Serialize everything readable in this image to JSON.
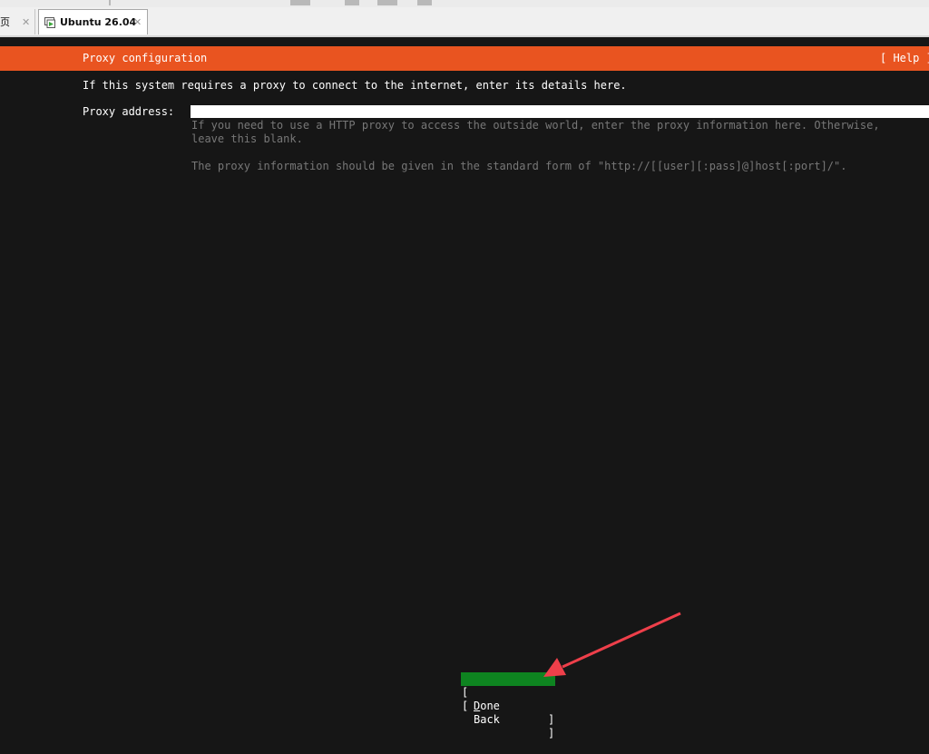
{
  "vm_tabs": {
    "home_label": "页",
    "home_close": "✕",
    "active_label": "Ubuntu 26.04",
    "active_close": "✕"
  },
  "installer": {
    "header_title": "Proxy configuration",
    "header_help": "[ Help ]",
    "intro": "If this system requires a proxy to connect to the internet, enter its details here.",
    "proxy_label": "Proxy address:",
    "proxy_value": "",
    "help_line1": "If you need to use a HTTP proxy to access the outside world, enter the proxy information here. Otherwise,",
    "help_line2": "leave this blank.",
    "help_line3": "The proxy information should be given in the standard form of \"http://[[user][:pass]@]host[:port]/\".",
    "done_first": "D",
    "done_rest": "one",
    "back_label": "Back",
    "bracket_left": "[",
    "bracket_right": "]"
  },
  "colors": {
    "header_bg": "#e95420",
    "done_bg": "#0e8420",
    "terminal_bg": "#161616",
    "arrow": "#ee3f4a"
  }
}
